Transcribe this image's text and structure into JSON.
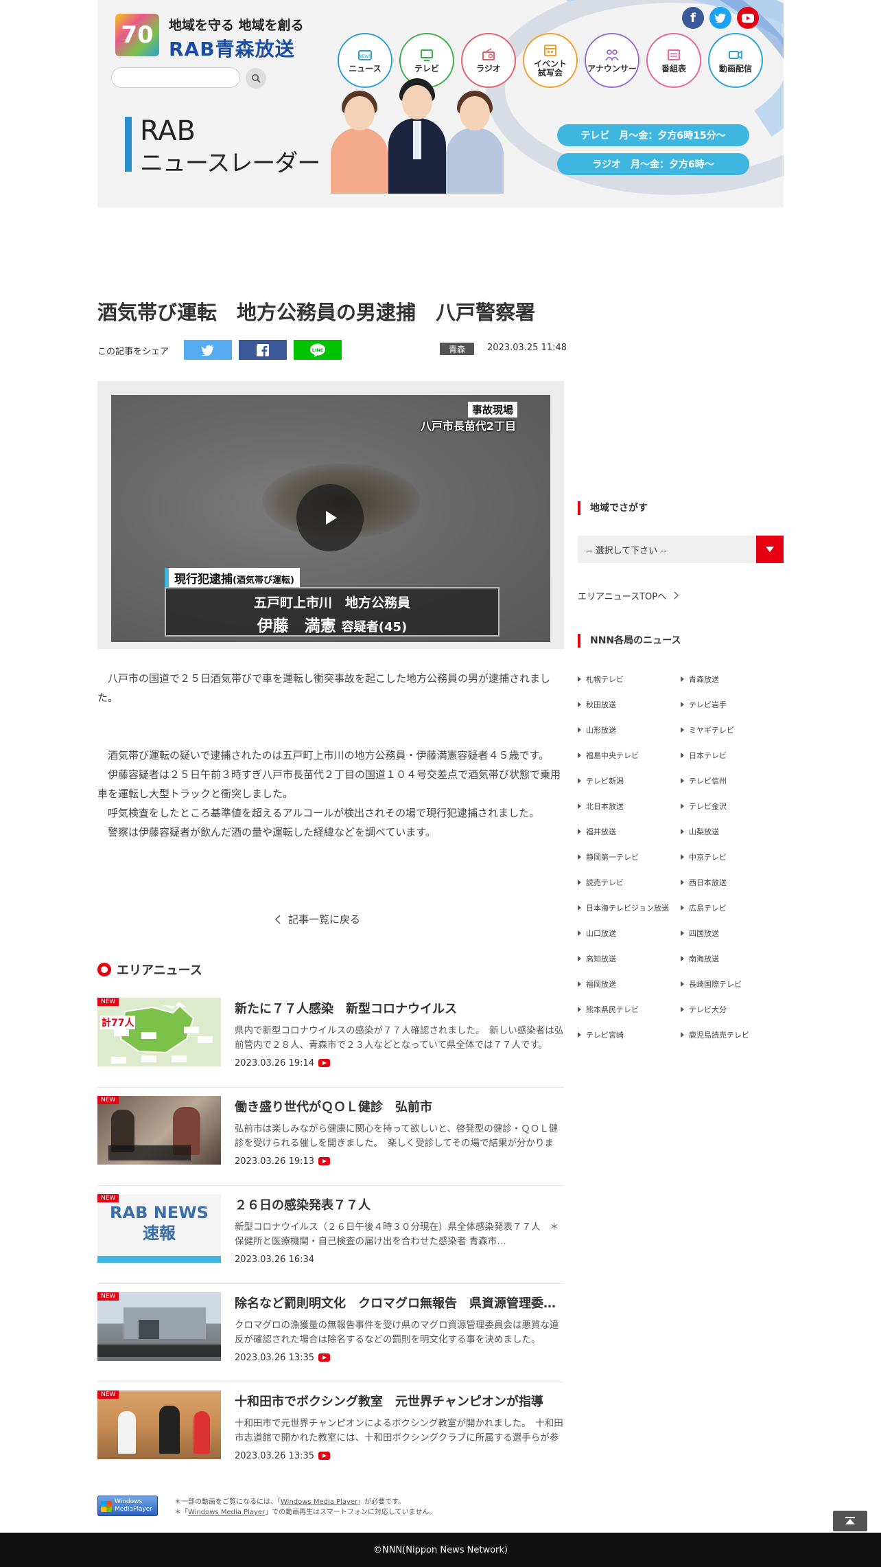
{
  "header": {
    "logo_badge": "70",
    "logo_slogan": "地域を守る 地域を創る",
    "logo_name": "RAB青森放送",
    "search_placeholder": "",
    "nav": [
      {
        "label": "ニュース",
        "color": "#2aa0d9"
      },
      {
        "label": "テレビ",
        "color": "#3cae4a"
      },
      {
        "label": "ラジオ",
        "color": "#e0606d"
      },
      {
        "label": "イベント\n試写会",
        "color": "#f0a030"
      },
      {
        "label": "アナウンサー",
        "color": "#9b6bd0"
      },
      {
        "label": "番組表",
        "color": "#e8639a"
      },
      {
        "label": "動画配信",
        "color": "#2aa0d9"
      }
    ],
    "sns": [
      "facebook-icon",
      "twitter-icon",
      "youtube-icon"
    ]
  },
  "banner": {
    "title_top": "RAB",
    "title_sub": "ニュースレーダー",
    "tv_schedule": "テレビ　月～金：夕方6時15分～",
    "radio_schedule": "ラジオ　月～金：夕方6時～"
  },
  "article": {
    "title": "酒気帯び運転　地方公務員の男逮捕　八戸警察署",
    "share_label": "この記事をシェア",
    "share_line": "LINE",
    "area": "青森",
    "date": "2023.03.25 11:48",
    "video": {
      "scene_tag": "事故現場",
      "scene_place": "八戸市長苗代2丁目",
      "arrest_tag": "現行犯逮捕",
      "arrest_sub": "(酒気帯び運転)",
      "caption_line1": "五戸町上市川　地方公務員",
      "caption_name": "伊藤　満憲",
      "caption_suffix": "容疑者(45)"
    },
    "paragraphs": [
      "　八戸市の国道で２５日酒気帯びで車を運転し衝突事故を起こした地方公務員の男が逮捕されました。",
      "　酒気帯び運転の疑いで逮捕されたのは五戸町上市川の地方公務員・伊藤満憲容疑者４５歳です。",
      "　伊藤容疑者は２５日午前３時すぎ八戸市長苗代２丁目の国道１０４号交差点で酒気帯び状態で乗用車を運転し大型トラックと衝突しました。",
      "　呼気検査をしたところ基準値を超えるアルコールが検出されその場で現行犯逮捕されました。",
      "　警察は伊藤容疑者が飲んだ酒の量や運転した経緯などを調べています。"
    ],
    "back_link": "記事一覧に戻る"
  },
  "area_news": {
    "heading": "エリアニュース",
    "badge": "NEW",
    "items": [
      {
        "title": "新たに７７人感染　新型コロナウイルス",
        "desc": "県内で新型コロナウイルスの感染が７７人確認されました。　新しい感染者は弘前管内で２８人、青森市で２３人などとなっていて県全体では７７人です。",
        "date": "2023.03.26 19:14",
        "video": true,
        "thumb_text": "計77人"
      },
      {
        "title": "働き盛り世代がＱＯＬ健診　弘前市",
        "desc": "弘前市は楽しみながら健康に関心を持って欲しいと、啓発型の健診・ＱＯＬ健診を受けられる催しを開きました。　楽しく受診してその場で結果が分かります。",
        "date": "2023.03.26 19:13",
        "video": true,
        "thumb_text": ""
      },
      {
        "title": "２６日の感染発表７７人",
        "desc": "新型コロナウイルス（２６日午後４時３０分現在）県全体感染発表７７人　＊保健所と医療機関・自己検査の届け出を合わせた感染者 青森市…",
        "date": "2023.03.26 16:34",
        "video": false,
        "thumb_text": "RAB NEWS\n速報"
      },
      {
        "title": "除名など罰則明文化　クロマグロ無報告　県資源管理委員会",
        "desc": "クロマグロの漁獲量の無報告事件を受け県のマグロ資源管理委員会は悪質な違反が確認された場合は除名するなどの罰則を明文化する事を決めました。",
        "date": "2023.03.26 13:35",
        "video": true,
        "thumb_text": ""
      },
      {
        "title": "十和田市でボクシング教室　元世界チャンピオンが指導",
        "desc": "十和田市で元世界チャンピオンによるボクシング教室が開かれました。　十和田市志道館で開かれた教室には、十和田ボクシングクラブに所属する選手らが参加しました。",
        "date": "2023.03.26 13:35",
        "video": true,
        "thumb_text": ""
      }
    ]
  },
  "sidebar": {
    "region_heading": "地域でさがす",
    "region_select": "-- 選択して下さい --",
    "area_top_link": "エリアニュースTOPへ",
    "nnn_heading": "NNN各局のニュース",
    "stations": [
      "札幌テレビ",
      "青森放送",
      "秋田放送",
      "テレビ岩手",
      "山形放送",
      "ミヤギテレビ",
      "福島中央テレビ",
      "日本テレビ",
      "テレビ新潟",
      "テレビ信州",
      "北日本放送",
      "テレビ金沢",
      "福井放送",
      "山梨放送",
      "静岡第一テレビ",
      "中京テレビ",
      "読売テレビ",
      "西日本放送",
      "日本海テレビジョン放送",
      "広島テレビ",
      "山口放送",
      "四国放送",
      "高知放送",
      "南海放送",
      "福岡放送",
      "長崎国際テレビ",
      "熊本県民テレビ",
      "テレビ大分",
      "テレビ宮崎",
      "鹿児島読売テレビ"
    ]
  },
  "footer": {
    "wmp_badge": "Windows MediaPlayer",
    "note1_pre": "＊一部の動画をご覧になるには、「",
    "note1_link": "Windows Media Player",
    "note1_post": "」が必要です。",
    "note2_pre": "＊「",
    "note2_link": "Windows Media Player",
    "note2_post": "」での動画再生はスマートフォンに対応していません。",
    "copyright": "©NNN(Nippon News Network)"
  }
}
